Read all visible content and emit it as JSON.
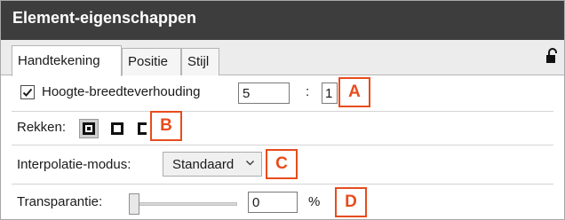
{
  "panel": {
    "title": "Element-eigenschappen",
    "lock_icon": "open-padlock-icon"
  },
  "tabs": [
    {
      "label": "Handtekening",
      "active": true
    },
    {
      "label": "Positie",
      "active": false
    },
    {
      "label": "Stijl",
      "active": false
    }
  ],
  "aspect_ratio": {
    "checked": true,
    "label": "Hoogte-breedteverhouding",
    "height_value": "5",
    "separator": ":",
    "width_value": "1"
  },
  "stretch": {
    "label": "Rekken:",
    "options": [
      {
        "icon": "stretch-fit-icon",
        "selected": true
      },
      {
        "icon": "stretch-fill-icon",
        "selected": false
      },
      {
        "icon": "stretch-horizontal-icon",
        "selected": false
      }
    ]
  },
  "interpolation": {
    "label": "Interpolatie-modus:",
    "value": "Standaard"
  },
  "transparency": {
    "label": "Transparantie:",
    "value": "0",
    "unit": "%",
    "slider_level": 0
  },
  "callouts": [
    "A",
    "B",
    "C",
    "D"
  ],
  "colors": {
    "titlebar": "#3d3d3d",
    "callout": "#e74c1c"
  }
}
